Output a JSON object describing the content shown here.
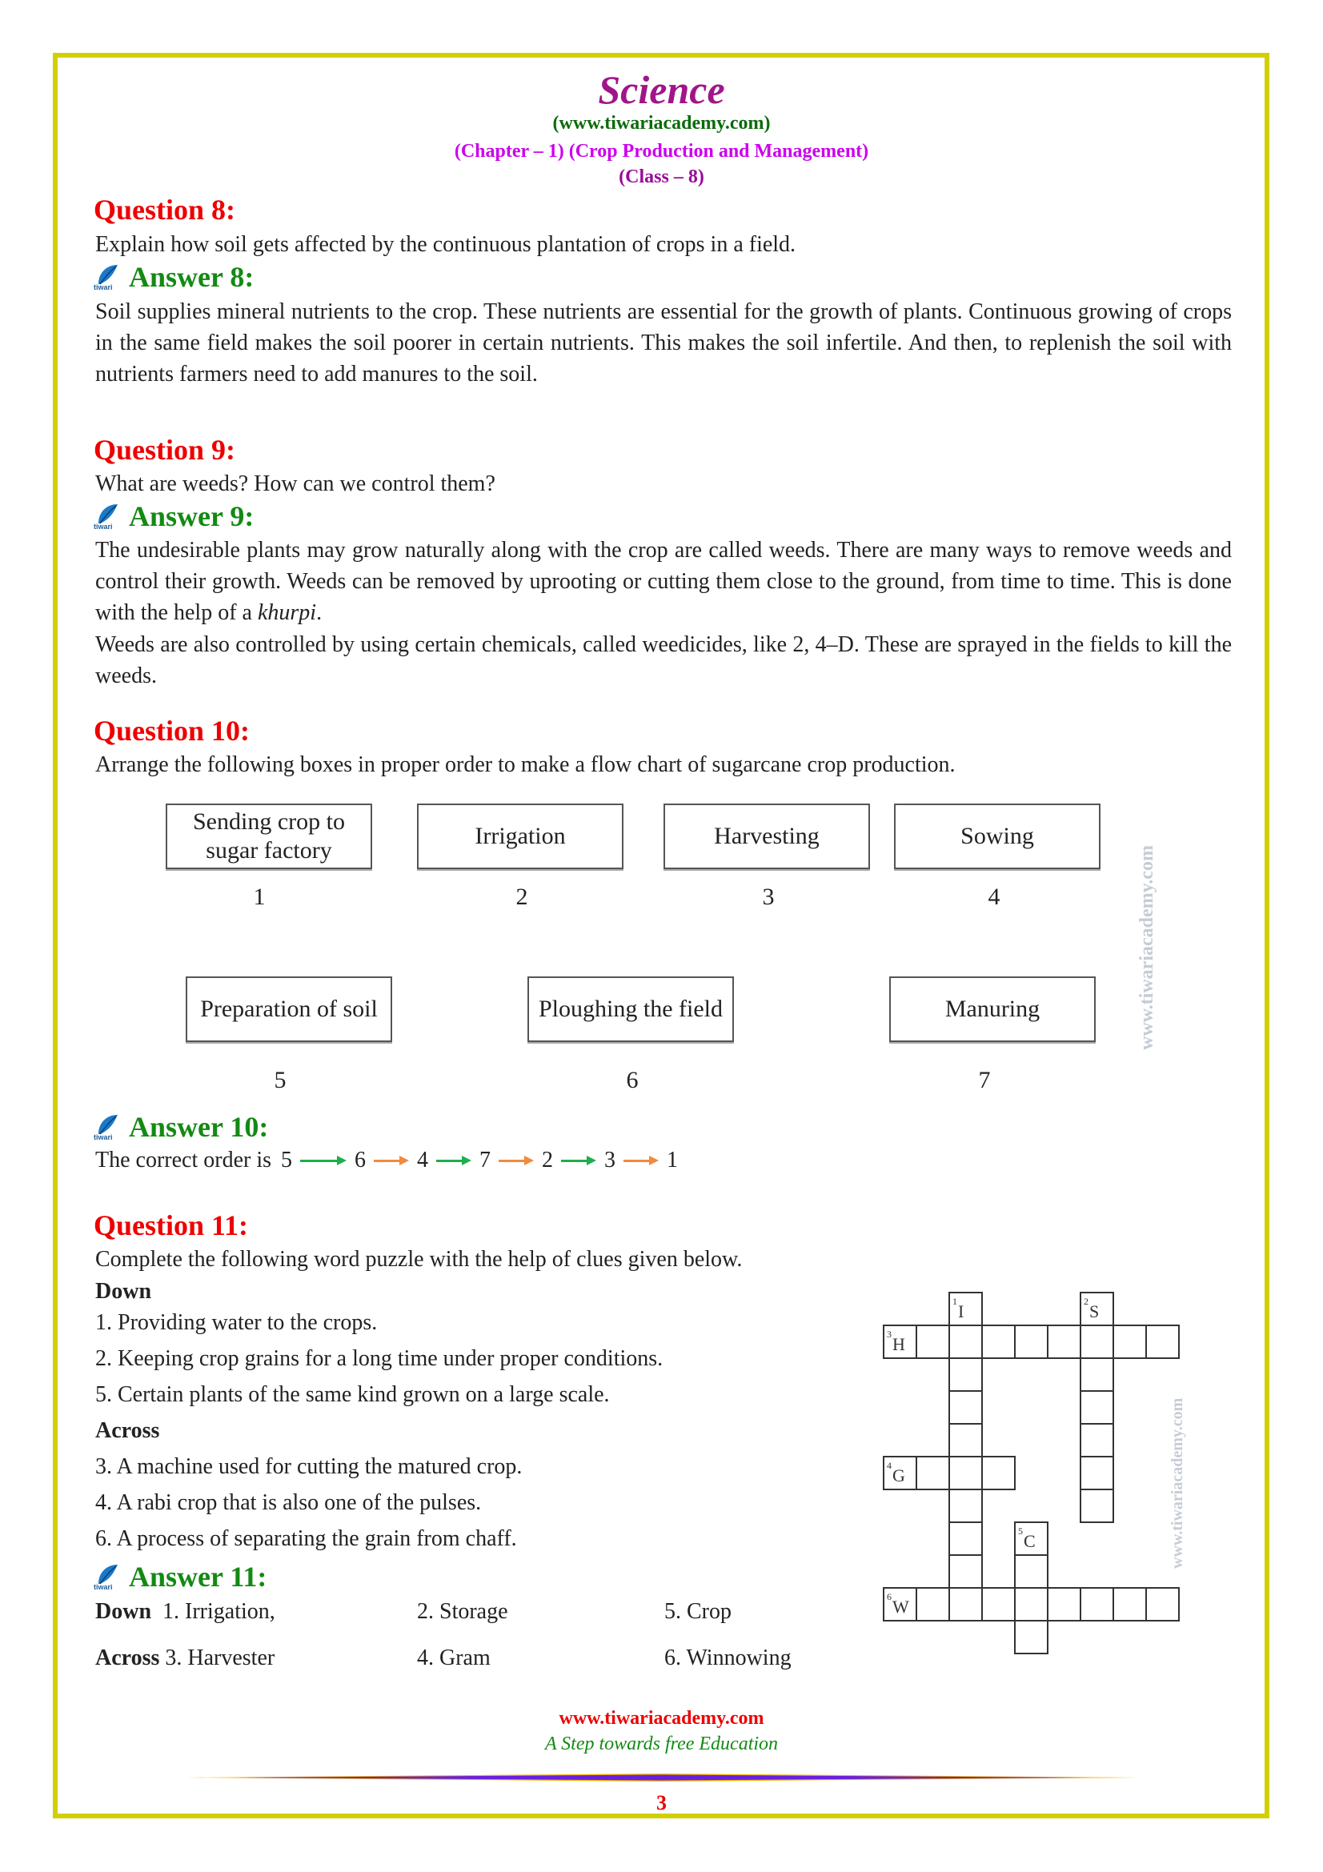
{
  "header": {
    "title": "Science",
    "website": "(www.tiwariacademy.com)",
    "chapter": "(Chapter – 1) (Crop Production and Management)",
    "class": "(Class – 8)"
  },
  "colors": {
    "frame": "#d0d000",
    "question_heading": "#ee0000",
    "answer_heading": "#138a13",
    "title": "#a0158a",
    "chapter": "#cc00ee",
    "arrow_green": "#1fae4b",
    "arrow_orange": "#f08a3c"
  },
  "q8": {
    "heading": "Question 8:",
    "question": "Explain how soil gets affected by the continuous plantation of crops in a field.",
    "answer_heading": "Answer 8:",
    "answer": "Soil supplies mineral nutrients to the crop. These nutrients are essential for the growth of plants. Continuous growing of crops in the same field makes the soil poorer in certain nutrients. This makes the soil infertile. And then, to replenish the soil with nutrients farmers need to add manures to the soil."
  },
  "q9": {
    "heading": "Question 9:",
    "question": "What are weeds? How can we control them?",
    "answer_heading": "Answer 9:",
    "answer_p1_before": "The undesirable plants may grow naturally along with the crop are called weeds. There are many ways to remove weeds and control their growth. Weeds can be removed by uprooting or cutting them close to the ground, from time to time. This is done with the help of a ",
    "answer_p1_italic": "khurpi",
    "answer_p1_after": ".",
    "answer_p2": "Weeds are also controlled by using certain chemicals, called weedicides, like 2, 4–D. These are sprayed in the fields to kill the weeds."
  },
  "q10": {
    "heading": "Question 10:",
    "question": "Arrange the following boxes in proper order to make a flow chart of sugarcane crop production.",
    "boxes": [
      {
        "label": "Sending crop to sugar factory",
        "number": "1"
      },
      {
        "label": "Irrigation",
        "number": "2"
      },
      {
        "label": "Harvesting",
        "number": "3"
      },
      {
        "label": "Sowing",
        "number": "4"
      },
      {
        "label": "Preparation of soil",
        "number": "5"
      },
      {
        "label": "Ploughing the field",
        "number": "6"
      },
      {
        "label": "Manuring",
        "number": "7"
      }
    ],
    "watermark": "www.tiwariacademy.com",
    "answer_heading": "Answer 10:",
    "answer_prefix": "The correct order is",
    "order": [
      "5",
      "6",
      "4",
      "7",
      "2",
      "3",
      "1"
    ],
    "arrow_colors": [
      "green",
      "orange",
      "green",
      "orange",
      "green",
      "orange"
    ]
  },
  "q11": {
    "heading": "Question 11:",
    "question": "Complete the following word puzzle with the help of clues given below.",
    "down_label": "Down",
    "down_clues": [
      "1. Providing water to the crops.",
      "2. Keeping crop grains for a long time under proper conditions.",
      "5. Certain plants of the same kind grown on a large scale."
    ],
    "across_label": "Across",
    "across_clues": [
      "3. A machine used for cutting the matured crop.",
      "4. A rabi crop that is also one of the pulses.",
      "6. A process of separating the grain from chaff."
    ],
    "crossword": {
      "watermark": "www.tiwariacademy.com",
      "clues": [
        {
          "number": "1",
          "letter": "I",
          "direction": "down"
        },
        {
          "number": "2",
          "letter": "S",
          "direction": "down"
        },
        {
          "number": "3",
          "letter": "H",
          "direction": "across"
        },
        {
          "number": "4",
          "letter": "G",
          "direction": "across"
        },
        {
          "number": "5",
          "letter": "C",
          "direction": "down"
        },
        {
          "number": "6",
          "letter": "W",
          "direction": "across"
        }
      ]
    },
    "answer_heading": "Answer 11:",
    "answer_down_label": "Down",
    "answer_down": [
      "1. Irrigation,",
      "2. Storage",
      "5. Crop"
    ],
    "answer_across_label": "Across",
    "answer_across": [
      "3. Harvester",
      "4. Gram",
      "6. Winnowing"
    ]
  },
  "footer": {
    "website": "www.tiwariacademy.com",
    "tagline": "A Step towards free Education",
    "page_number": "3"
  },
  "logo": {
    "text": "tiwari"
  }
}
